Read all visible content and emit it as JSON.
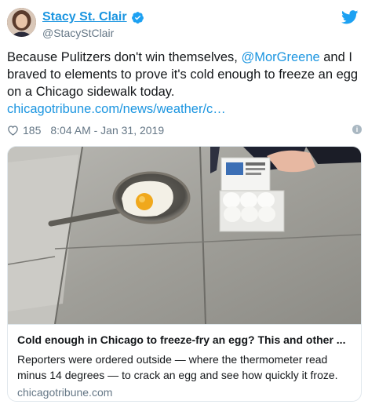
{
  "author": {
    "display_name": "Stacy St. Clair",
    "handle": "@StacyStClair"
  },
  "tweet": {
    "text_part1": "Because Pulitzers don't win themselves, ",
    "mention": "@MorGreene",
    "text_part2": " and I braved to elements to prove it's cold enough to freeze an egg on a Chicago sidewalk today.",
    "link": "chicagotribune.com/news/weather/c…"
  },
  "meta": {
    "likes": "185",
    "timestamp": "8:04 AM - Jan 31, 2019",
    "info_symbol": "i"
  },
  "card": {
    "title": "Cold enough in Chicago to freeze-fry an egg? This and other ...",
    "description": "Reporters were ordered outside — where the thermometer read minus 14 degrees — to crack an egg and see how quickly it froze.",
    "domain": "chicagotribune.com"
  },
  "icons": {
    "verified": "verified-badge-icon",
    "twitter": "twitter-bird-icon",
    "heart": "heart-icon",
    "info": "info-icon"
  },
  "colors": {
    "link_blue": "#1b95e0",
    "text": "#14171a",
    "muted": "#657786",
    "border": "#e1e8ed"
  }
}
